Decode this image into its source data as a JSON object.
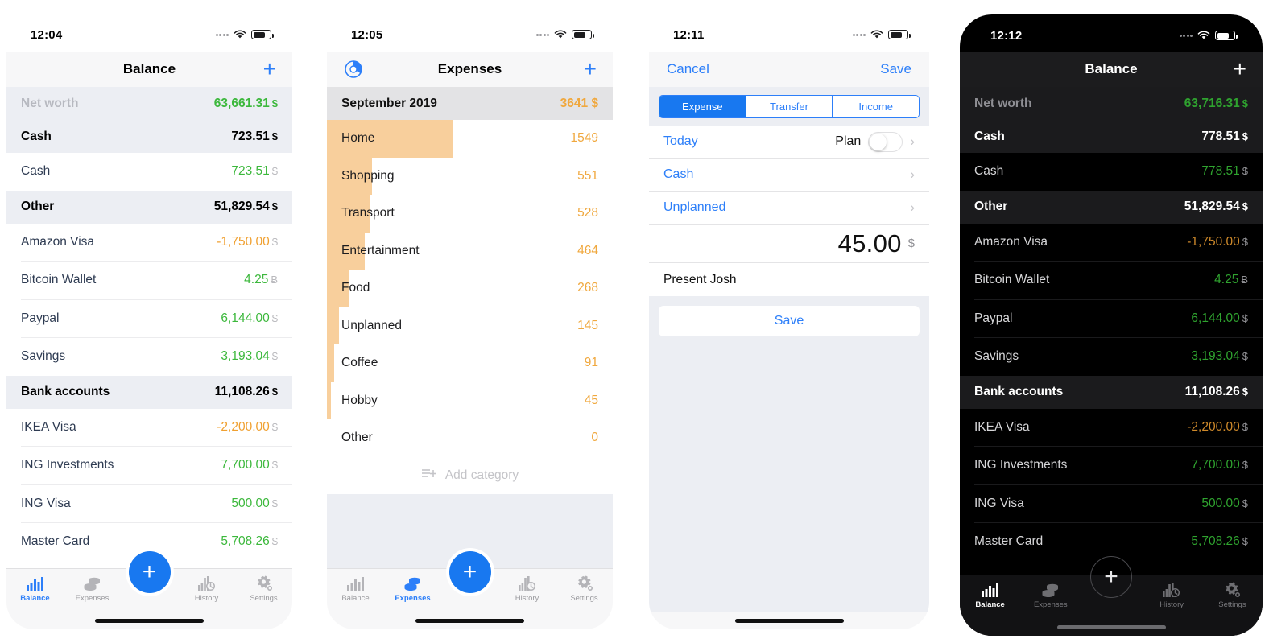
{
  "phones": {
    "balance_light": {
      "status": {
        "time": "12:04",
        "signal": "signal-dots-icon",
        "wifi": "wifi-icon",
        "battery": "battery-icon"
      },
      "nav": {
        "title": "Balance",
        "add": "+"
      },
      "rows": [
        {
          "type": "networth",
          "label": "Net worth",
          "value": "63,661.31",
          "currency": "$",
          "tone": "pos"
        },
        {
          "type": "group",
          "label": "Cash",
          "value": "723.51",
          "currency": "$",
          "tone": "plain"
        },
        {
          "type": "item",
          "label": "Cash",
          "value": "723.51",
          "currency": "$",
          "tone": "pos"
        },
        {
          "type": "group",
          "label": "Other",
          "value": "51,829.54",
          "currency": "$",
          "tone": "plain"
        },
        {
          "type": "item",
          "label": "Amazon Visa",
          "value": "-1,750.00",
          "currency": "$",
          "tone": "neg"
        },
        {
          "type": "item",
          "label": "Bitcoin Wallet",
          "value": "4.25",
          "currency": "Ƀ",
          "tone": "pos"
        },
        {
          "type": "item",
          "label": "Paypal",
          "value": "6,144.00",
          "currency": "$",
          "tone": "pos"
        },
        {
          "type": "item",
          "label": "Savings",
          "value": "3,193.04",
          "currency": "$",
          "tone": "pos"
        },
        {
          "type": "group",
          "label": "Bank accounts",
          "value": "11,108.26",
          "currency": "$",
          "tone": "plain"
        },
        {
          "type": "item",
          "label": "IKEA Visa",
          "value": "-2,200.00",
          "currency": "$",
          "tone": "neg"
        },
        {
          "type": "item",
          "label": "ING Investments",
          "value": "7,700.00",
          "currency": "$",
          "tone": "pos"
        },
        {
          "type": "item",
          "label": "ING Visa",
          "value": "500.00",
          "currency": "$",
          "tone": "pos"
        },
        {
          "type": "item",
          "label": "Master Card",
          "value": "5,708.26",
          "currency": "$",
          "tone": "pos"
        }
      ],
      "tabs": [
        {
          "label": "Balance",
          "icon": "bar-chart-icon",
          "active": true
        },
        {
          "label": "Expenses",
          "icon": "coins-icon",
          "active": false
        },
        {
          "label": "History",
          "icon": "history-icon",
          "active": false
        },
        {
          "label": "Settings",
          "icon": "gear-icon",
          "active": false
        }
      ],
      "fab": "+"
    },
    "expenses": {
      "status": {
        "time": "12:05"
      },
      "nav": {
        "title": "Expenses",
        "add": "+",
        "left_icon": "pie-chart-icon"
      },
      "period": {
        "label": "September 2019",
        "value": "3641",
        "currency": "$"
      },
      "add_category": {
        "label": "Add category",
        "icon": "add-list-icon"
      },
      "tabs": [
        {
          "label": "Balance",
          "icon": "bar-chart-icon",
          "active": false
        },
        {
          "label": "Expenses",
          "icon": "coins-icon",
          "active": true
        },
        {
          "label": "History",
          "icon": "history-icon",
          "active": false
        },
        {
          "label": "Settings",
          "icon": "gear-icon",
          "active": false
        }
      ],
      "fab": "+"
    },
    "transaction_form": {
      "status": {
        "time": "12:11"
      },
      "nav": {
        "cancel": "Cancel",
        "save": "Save"
      },
      "segments": [
        {
          "label": "Expense",
          "selected": true
        },
        {
          "label": "Transfer",
          "selected": false
        },
        {
          "label": "Income",
          "selected": false
        }
      ],
      "fields": {
        "date": "Today",
        "plan_label": "Plan",
        "plan_on": false,
        "account": "Cash",
        "category": "Unplanned",
        "amount": "45.00",
        "currency": "$",
        "note": "Present Josh"
      },
      "save_button": "Save"
    },
    "balance_dark": {
      "status": {
        "time": "12:12"
      },
      "nav": {
        "title": "Balance",
        "add": "+"
      },
      "rows": [
        {
          "type": "networth",
          "label": "Net worth",
          "value": "63,716.31",
          "currency": "$",
          "tone": "pos"
        },
        {
          "type": "group",
          "label": "Cash",
          "value": "778.51",
          "currency": "$",
          "tone": "plain"
        },
        {
          "type": "item",
          "label": "Cash",
          "value": "778.51",
          "currency": "$",
          "tone": "pos"
        },
        {
          "type": "group",
          "label": "Other",
          "value": "51,829.54",
          "currency": "$",
          "tone": "plain"
        },
        {
          "type": "item",
          "label": "Amazon Visa",
          "value": "-1,750.00",
          "currency": "$",
          "tone": "neg"
        },
        {
          "type": "item",
          "label": "Bitcoin Wallet",
          "value": "4.25",
          "currency": "Ƀ",
          "tone": "pos"
        },
        {
          "type": "item",
          "label": "Paypal",
          "value": "6,144.00",
          "currency": "$",
          "tone": "pos"
        },
        {
          "type": "item",
          "label": "Savings",
          "value": "3,193.04",
          "currency": "$",
          "tone": "pos"
        },
        {
          "type": "group",
          "label": "Bank accounts",
          "value": "11,108.26",
          "currency": "$",
          "tone": "plain"
        },
        {
          "type": "item",
          "label": "IKEA Visa",
          "value": "-2,200.00",
          "currency": "$",
          "tone": "neg"
        },
        {
          "type": "item",
          "label": "ING Investments",
          "value": "7,700.00",
          "currency": "$",
          "tone": "pos"
        },
        {
          "type": "item",
          "label": "ING Visa",
          "value": "500.00",
          "currency": "$",
          "tone": "pos"
        },
        {
          "type": "item",
          "label": "Master Card",
          "value": "5,708.26",
          "currency": "$",
          "tone": "pos"
        }
      ],
      "tabs": [
        {
          "label": "Balance",
          "icon": "bar-chart-icon",
          "active": true
        },
        {
          "label": "Expenses",
          "icon": "coins-icon",
          "active": false
        },
        {
          "label": "History",
          "icon": "history-icon",
          "active": false
        },
        {
          "label": "Settings",
          "icon": "gear-icon",
          "active": false
        }
      ],
      "fab": "+"
    }
  },
  "colors": {
    "accent_blue": "#1878f0",
    "positive_green": "#3cb83c",
    "negative_orange": "#f0a030",
    "expense_orange": "#f0a83e",
    "expense_bar": "#f8cf9c"
  },
  "chart_data": {
    "type": "bar",
    "title": "September 2019",
    "orientation": "horizontal",
    "total": 3641,
    "currency": "$",
    "xlabel": "",
    "ylabel": "",
    "grid": false,
    "legend": "none",
    "categories": [
      "Home",
      "Shopping",
      "Transport",
      "Entertainment",
      "Food",
      "Unplanned",
      "Coffee",
      "Hobby",
      "Other"
    ],
    "values": [
      1549,
      551,
      528,
      464,
      268,
      145,
      91,
      45,
      0
    ],
    "xlim": [
      0,
      1549
    ]
  }
}
